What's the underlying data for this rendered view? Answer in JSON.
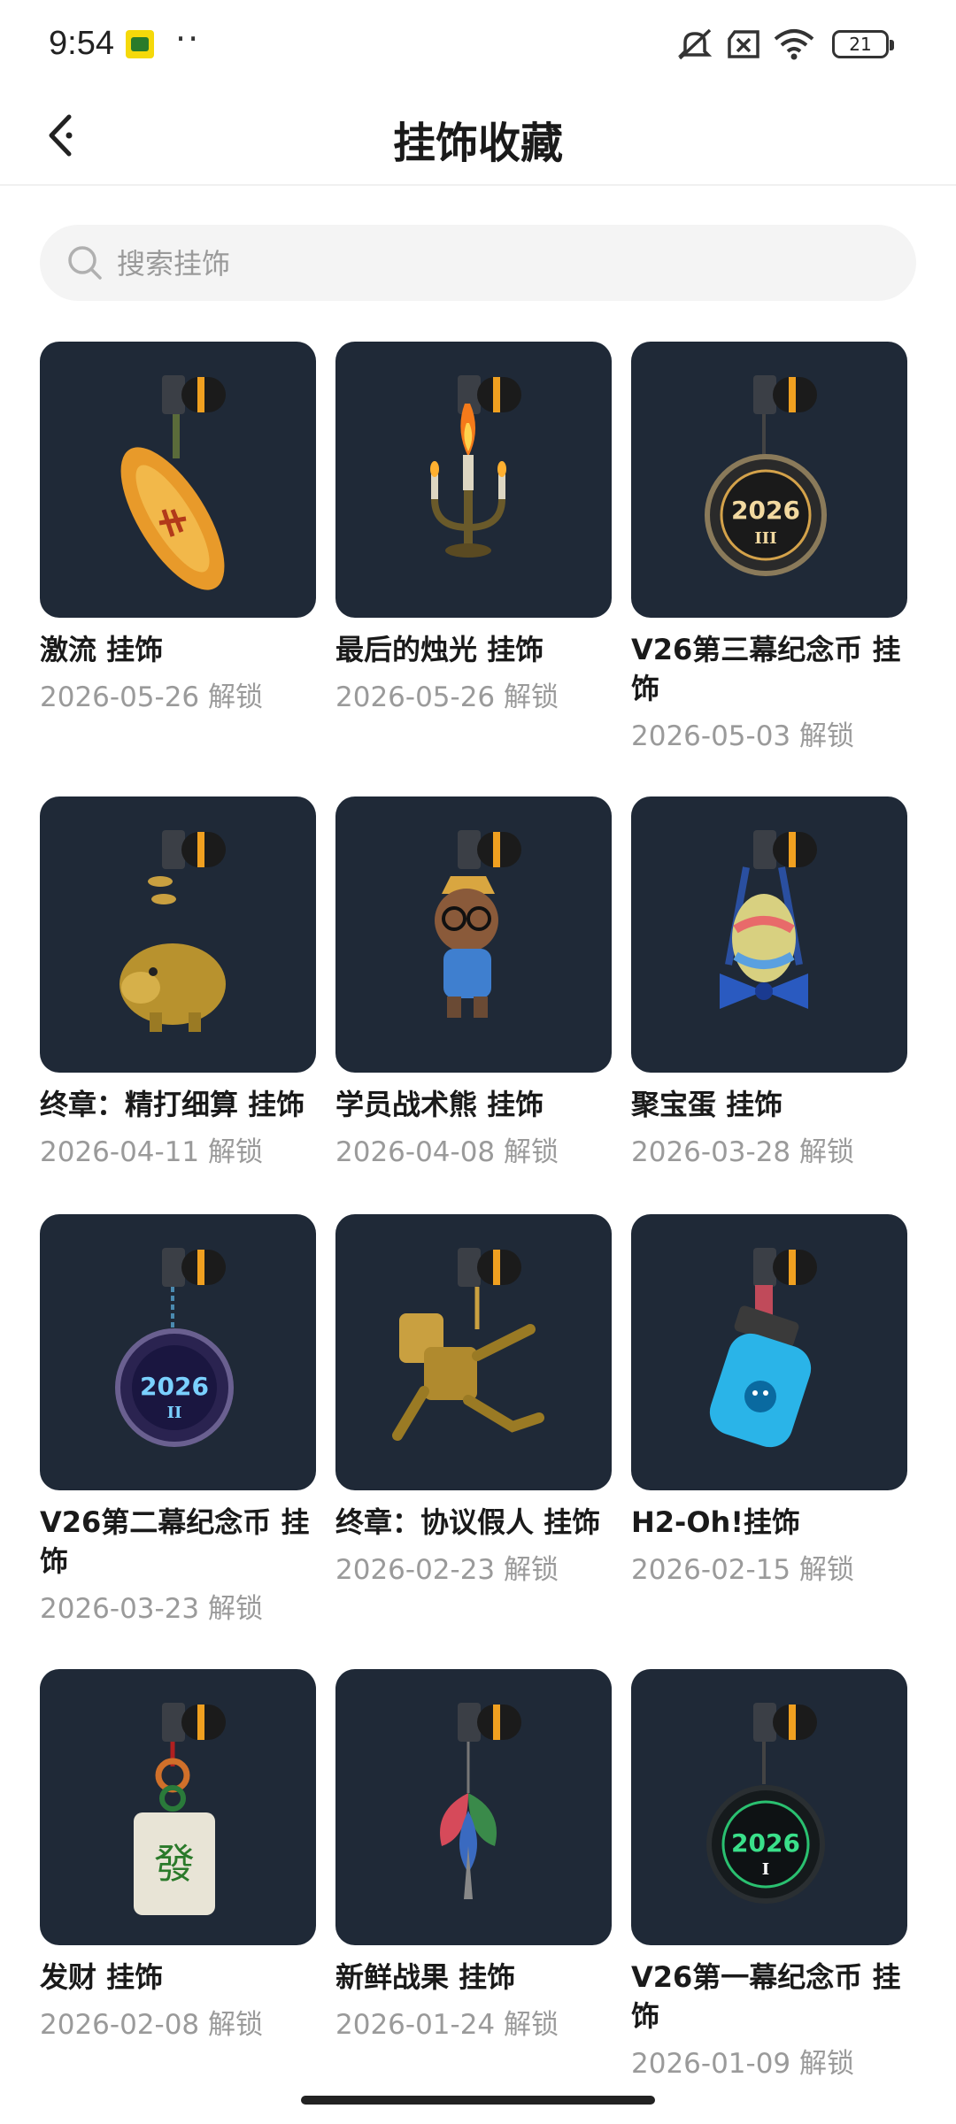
{
  "status": {
    "time": "9:54",
    "battery": "21"
  },
  "header": {
    "title": "挂饰收藏"
  },
  "search": {
    "placeholder": "搜索挂饰"
  },
  "items": [
    {
      "name": "激流 挂饰",
      "date": "2026-05-26 解锁",
      "icon": "surfboard-charm"
    },
    {
      "name": "最后的烛光 挂饰",
      "date": "2026-05-26 解锁",
      "icon": "candelabra-charm"
    },
    {
      "name": "V26第三幕纪念币 挂饰",
      "date": "2026-05-03 解锁",
      "icon": "coin-charm-2026-iii"
    },
    {
      "name": "终章：精打细算 挂饰",
      "date": "2026-04-11 解锁",
      "icon": "piggy-bank-charm"
    },
    {
      "name": "学员战术熊 挂饰",
      "date": "2026-04-08 解锁",
      "icon": "bear-charm"
    },
    {
      "name": "聚宝蛋 挂饰",
      "date": "2026-03-28 解锁",
      "icon": "egg-basket-charm"
    },
    {
      "name": "V26第二幕纪念币 挂饰",
      "date": "2026-03-23 解锁",
      "icon": "coin-charm-2026-ii"
    },
    {
      "name": "终章：协议假人 挂饰",
      "date": "2026-02-23 解锁",
      "icon": "gold-dummy-charm"
    },
    {
      "name": "H2-Oh!挂饰",
      "date": "2026-02-15 解锁",
      "icon": "water-bottle-charm"
    },
    {
      "name": "发财 挂饰",
      "date": "2026-02-08 解锁",
      "icon": "mahjong-tile-charm"
    },
    {
      "name": "新鲜战果 挂饰",
      "date": "2026-01-24 解锁",
      "icon": "leaf-charm"
    },
    {
      "name": "V26第一幕纪念币 挂饰",
      "date": "2026-01-09 解锁",
      "icon": "coin-charm-2026-i"
    }
  ],
  "coin_labels": {
    "year": "2026",
    "iii": "III",
    "ii": "II",
    "i": "I"
  },
  "tile_glyph": "發",
  "colors": {
    "card_bg": "#1f2937",
    "accent_orange": "#f0a020",
    "date_gray": "#9a9a9a"
  }
}
